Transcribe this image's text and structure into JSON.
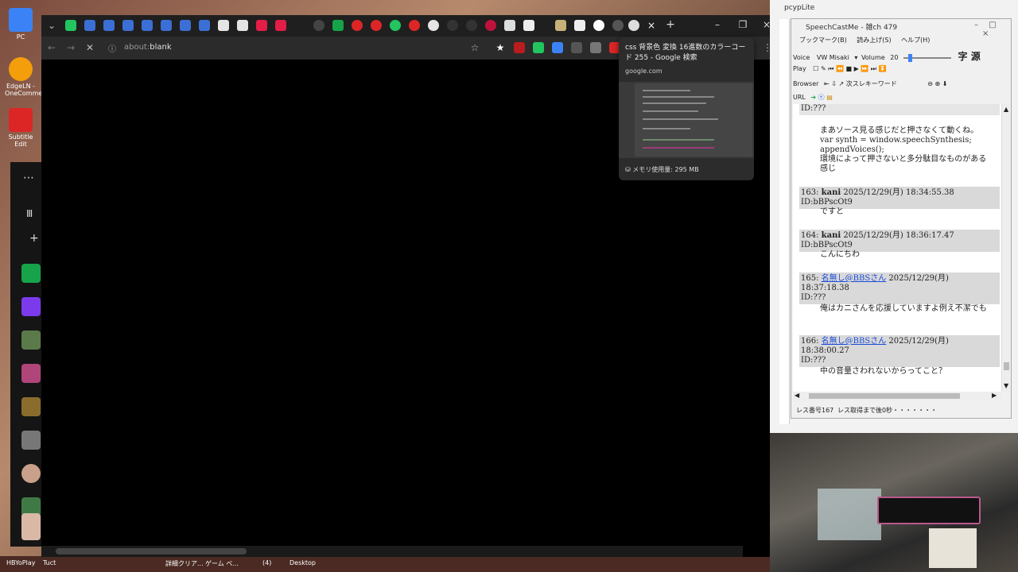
{
  "desktop": {
    "icons": [
      {
        "label": "PC"
      },
      {
        "label": "EdgeLN - OneComme"
      },
      {
        "label": "Subtitle Edit"
      }
    ],
    "tray": [
      "HBYoPlay",
      "Tuct",
      "詳細クリア...",
      "ゲーム ペ...",
      "(4)",
      "Desktop"
    ]
  },
  "browser": {
    "url_prefix": "about:",
    "url_main": "blank",
    "hovercard": {
      "title": "css 背景色 変換 16進数のカラーコード 255 - Google 検索",
      "domain": "google.com",
      "memory": "メモリ使用量: 295 MB"
    }
  },
  "pcyp": {
    "title": "pcypLite"
  },
  "speechcast": {
    "title": "SpeechCastMe - 雑ch 479",
    "menu": [
      "ブックマーク(B)",
      "読み上げ(S)",
      "ヘルプ(H)"
    ],
    "voice_label": "Voice",
    "voice_value": "VW Misaki",
    "volume_label": "Volume",
    "volume_value": "20",
    "font_label": "字 源",
    "play_label": "Play",
    "browser_label": "Browser",
    "keyword_label": "次スレキーワード",
    "url_label": "URL",
    "posts": [
      {
        "head_tail": "ID:???",
        "body": "まあソース見る感じだと押さなくて動くね。\nvar synth = window.speechSynthesis;\nappendVoices();\n環境によって押さないと多分駄目なものがある感じ"
      },
      {
        "num": "163:",
        "name": "kani",
        "date": "2025/12/29(月) 18:34:55.38 ID:bBPscOt9",
        "body": "ですと"
      },
      {
        "num": "164:",
        "name": "kani",
        "date": "2025/12/29(月) 18:36:17.47 ID:bBPscOt9",
        "body": "こんにちわ"
      },
      {
        "num": "165:",
        "name": "名無し@BBSさん",
        "date": "2025/12/29(月) 18:37:18.38",
        "id": "ID:???",
        "body": "俺はカニさんを応援していますよ例え不潔でも"
      },
      {
        "num": "166:",
        "name": "名無し@BBSさん",
        "date": "2025/12/29(月) 18:38:00.27",
        "id": "ID:???",
        "body": "中の音量さわれないからってこと？"
      }
    ],
    "status_left": "レス番号167",
    "status_right": "レス取得まで後0秒・・・・・・・"
  },
  "colors": {
    "browser_bg": "#000000",
    "tabbar": "#1f1f1f",
    "link": "#1a4bd6",
    "post_head_bg": "#d9d9d9"
  }
}
